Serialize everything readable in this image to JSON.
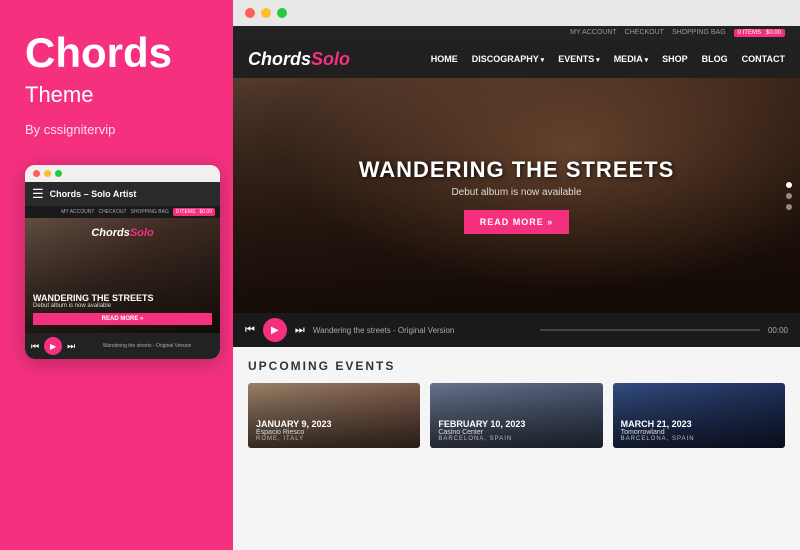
{
  "left": {
    "title": "Chords",
    "subtitle": "Theme",
    "author": "By cssignitervip"
  },
  "mobile": {
    "dots": [
      "red",
      "yellow",
      "green"
    ],
    "bar_title": "Chords – Solo Artist",
    "links_bar": [
      "MY ACCOUNT",
      "CHECKOUT",
      "SHOPPING BAG",
      "0 ITEMS",
      "$0.00"
    ],
    "logo": "Chords",
    "logo_color": "Solo",
    "hero_title": "WANDERING THE STREETS",
    "hero_sub": "Debut album is now available",
    "read_more": "READ MORE »",
    "player_label": "Wandering the streets - Original Version"
  },
  "browser": {
    "dots": [
      "red",
      "yellow",
      "green"
    ]
  },
  "site": {
    "nav_top": [
      "MY ACCOUNT",
      "CHECKOUT",
      "SHOPPING BAG",
      "0 ITEMS",
      "$0.00"
    ],
    "logo": "Chords",
    "logo_accent": "Solo",
    "nav_links": [
      {
        "label": "HOME",
        "dropdown": false
      },
      {
        "label": "DISCOGRAPHY",
        "dropdown": true
      },
      {
        "label": "EVENTS",
        "dropdown": true
      },
      {
        "label": "MEDIA",
        "dropdown": true
      },
      {
        "label": "SHOP",
        "dropdown": false
      },
      {
        "label": "BLOG",
        "dropdown": false
      },
      {
        "label": "CONTACT",
        "dropdown": false
      }
    ],
    "hero_title": "WANDERING THE STREETS",
    "hero_subtitle": "Debut album is now available",
    "hero_read_more": "READ MORE »",
    "player_label": "Wandering the streets - Original Version",
    "player_time": "00:00",
    "events_heading": "UPCOMING EVENTS",
    "events": [
      {
        "date": "JANUARY 9, 2023",
        "venue": "Espacio Riesco",
        "location": "ROME, ITALY"
      },
      {
        "date": "FEBRUARY 10, 2023",
        "venue": "Casino Center",
        "location": "BARCELONA, SPAIN"
      },
      {
        "date": "MARCH 21, 2023",
        "venue": "Tomorrowland",
        "location": "BARCELONA, SPAIN"
      }
    ]
  }
}
